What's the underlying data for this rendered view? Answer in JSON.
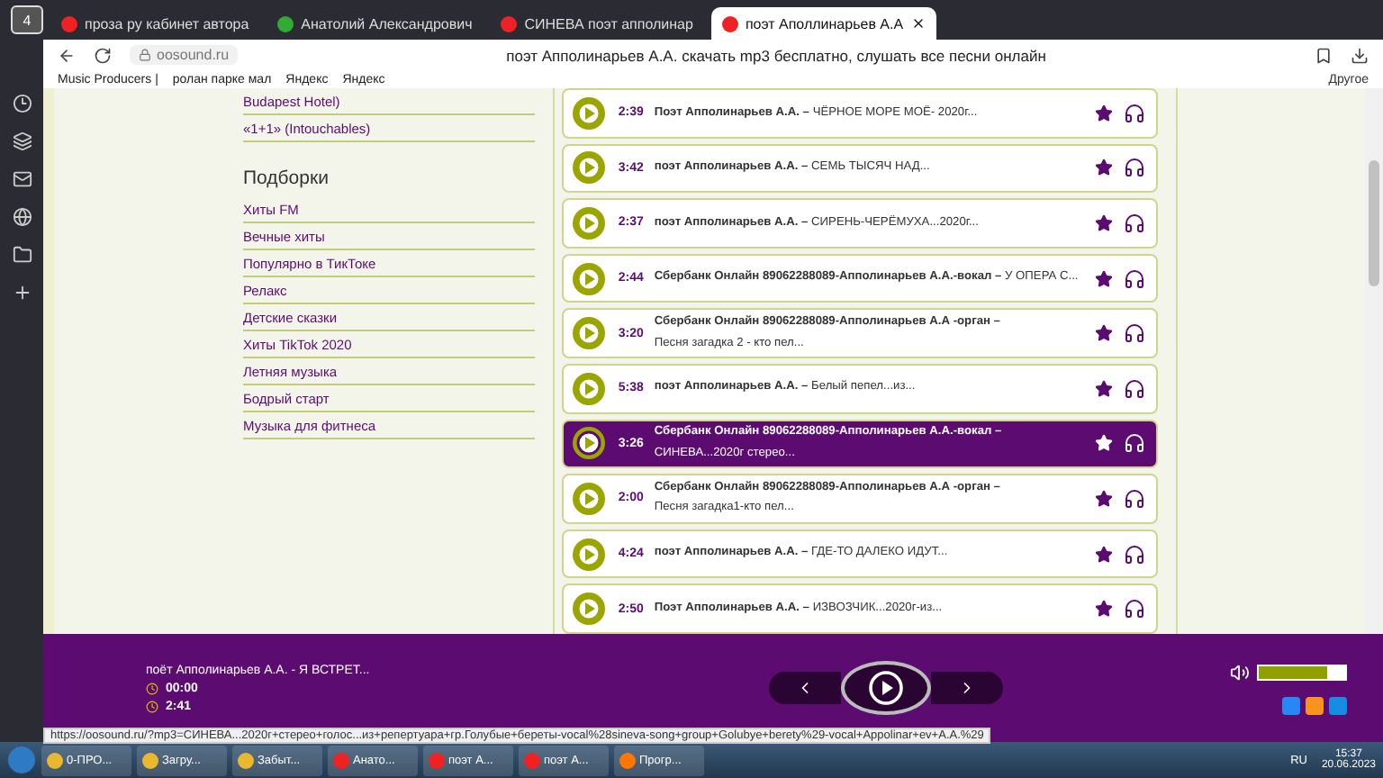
{
  "browser": {
    "tab_count": "4",
    "tabs": [
      {
        "title": "проза ру кабинет автора",
        "selected": false
      },
      {
        "title": "Анатолий Александрович",
        "selected": false
      },
      {
        "title": "СИНЕВА поэт апполинар",
        "selected": false
      },
      {
        "title": "поэт Аполлинарьев А.А",
        "selected": true
      }
    ],
    "address": "oosound.ru",
    "page_title": "поэт Апполинарьев А.А. скачать mp3 бесплатно, слушать все песни онлайн",
    "bookmarks": [
      "Music Producers |",
      "ролан парке мал",
      "Яндекс",
      "Яндекс"
    ],
    "other_bookmarks": "Другое"
  },
  "sidebar": {
    "top_items": [
      "Budapest Hotel)",
      "«1+1» (Intouchables)"
    ],
    "heading": "Подборки",
    "items": [
      "Хиты FM",
      "Вечные хиты",
      "Популярно в ТикТоке",
      "Релакс",
      "Детские сказки",
      "Хиты TikTok 2020",
      "Летняя музыка",
      "Бодрый старт",
      "Музыка для фитнеса"
    ]
  },
  "tracks": [
    {
      "kind": "single",
      "duration": "2:39",
      "artist": "Поэт Апполинарьев А.А. –",
      "title": "ЧЁРНОЕ МОРЕ МОЁ- 2020г...",
      "selected": false
    },
    {
      "kind": "single",
      "duration": "3:42",
      "artist": "поэт Апполинарьев А.А. –",
      "title": "СЕМЬ ТЫСЯЧ НАД...",
      "selected": false
    },
    {
      "kind": "single",
      "duration": "2:37",
      "artist": "поэт Апполинарьев А.А. –",
      "title": "СИРЕНЬ-ЧЕРЁМУХА...2020г...",
      "selected": false
    },
    {
      "kind": "single",
      "duration": "2:44",
      "artist": "Сбербанк Онлайн 89062288089-Апполинарьев А.А.-вокал –",
      "title": "У ОПЕРА С...",
      "selected": false
    },
    {
      "kind": "double",
      "duration": "3:20",
      "artist": "Сбербанк Онлайн 89062288089-Апполинарьев А.А -орган –",
      "title": "Песня загадка 2 - кто пел...",
      "selected": false
    },
    {
      "kind": "single",
      "duration": "5:38",
      "artist": "поэт Апполинарьев А.А. –",
      "title": "Белый пепел...из...",
      "selected": false
    },
    {
      "kind": "double",
      "duration": "3:26",
      "artist": "Сбербанк Онлайн 89062288089-Апполинарьев А.А.-вокал –",
      "title": "СИНЕВА...2020г стерео...",
      "selected": true
    },
    {
      "kind": "double",
      "duration": "2:00",
      "artist": "Сбербанк Онлайн 89062288089-Апполинарьев А.А -орган –",
      "title": "Песня загадка1-кто пел...",
      "selected": false
    },
    {
      "kind": "single",
      "duration": "4:24",
      "artist": "поэт Апполинарьев А.А. –",
      "title": "ГДЕ-ТО ДАЛЕКО ИДУТ...",
      "selected": false
    },
    {
      "kind": "single",
      "duration": "2:50",
      "artist": "Поэт Апполинарьев А.А. –",
      "title": "ИЗВОЗЧИК...2020г-из...",
      "selected": false
    }
  ],
  "player": {
    "now_playing": "поёт Апполинарьев А.А. - Я ВСТРЕТ...",
    "elapsed": "00:00",
    "total": "2:41",
    "volume": {
      "level": 0.8
    }
  },
  "status_url": "https://oosound.ru/?mp3=СИНЕВА...2020г+стерео+голос...из+репертуара+гр.Голубые+береты-vocal%28sineva-song+group+Golubye+berety%29-vocal+Appolinar+ev+A.A.%29",
  "taskbar": {
    "items": [
      "0-ПРО...",
      "Загру...",
      "Забыт...",
      "Анато...",
      "поэт А...",
      "поэт А...",
      "Прогр..."
    ],
    "language": "RU",
    "time": "15:37",
    "date": "20.06.2023"
  }
}
